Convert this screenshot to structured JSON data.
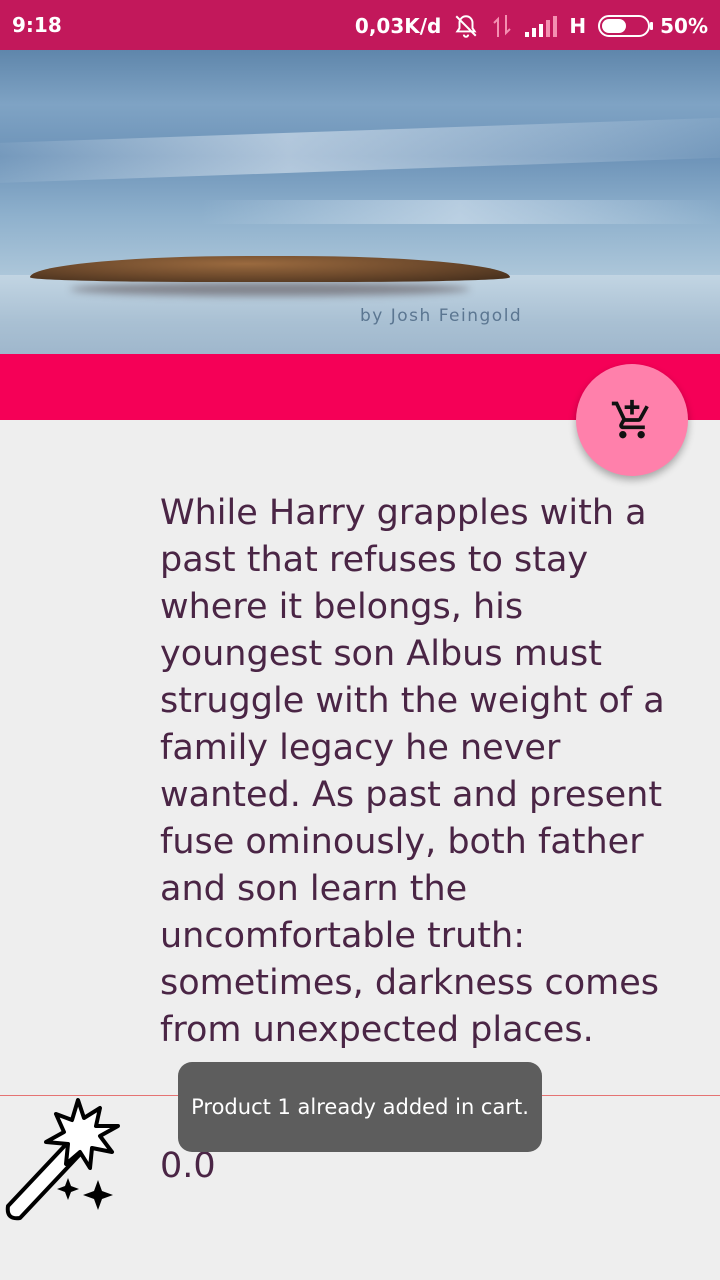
{
  "status_bar": {
    "time": "9:18",
    "network_speed": "0,03K/d",
    "network_type": "H",
    "battery": "50%",
    "icons": [
      "bell-off-icon",
      "data-transfer-icon",
      "signal-icon",
      "battery-icon"
    ]
  },
  "cover": {
    "author": "by Josh Feingold"
  },
  "fab": {
    "icon": "add-shopping-cart-icon"
  },
  "product": {
    "description": "While Harry grapples with a past that refuses to stay where it belongs, his youngest son Albus must struggle with the weight of a family legacy he never wanted. As past and present fuse ominously, both father and son learn the uncomfortable truth: sometimes, darkness comes from unexpected places.",
    "price": "0.0",
    "icon": "magic-wand-icon"
  },
  "toast": {
    "message": "Product 1 already added in cart."
  },
  "colors": {
    "status_bar": "#c2185b",
    "accent_band": "#f50057",
    "fab": "#ff80ab",
    "text": "#4a2545",
    "divider": "#e57373",
    "toast": "#5d5d5d"
  }
}
